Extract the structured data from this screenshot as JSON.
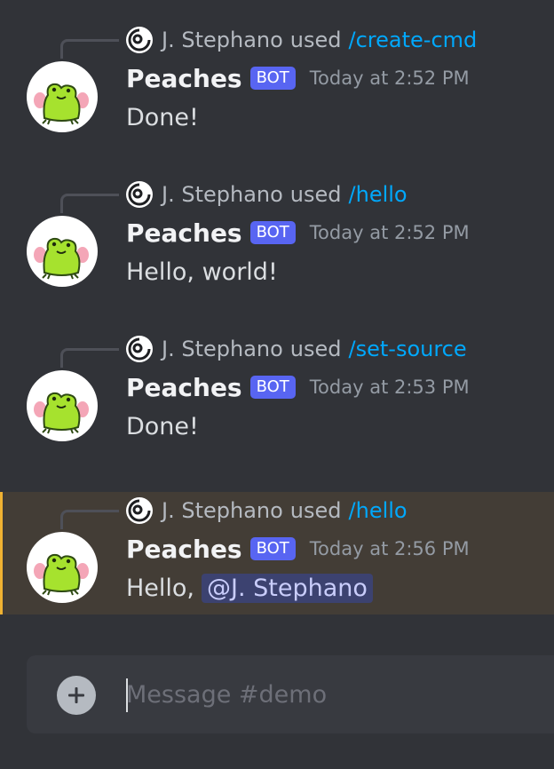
{
  "channel": {
    "composer_placeholder": "Message #demo"
  },
  "colors": {
    "background": "#313338",
    "bot_badge": "#5865f2",
    "command_link": "#00a8fc",
    "mention_bg": "#3c4270",
    "highlight_bg": "#433d36",
    "highlight_bar": "#f0b232"
  },
  "messages": [
    {
      "reply": {
        "user": "J. Stephano",
        "verb": "used",
        "command": "/create-cmd"
      },
      "author": "Peaches",
      "badge": "BOT",
      "timestamp": "Today at 2:52 PM",
      "text": "Done!"
    },
    {
      "reply": {
        "user": "J. Stephano",
        "verb": "used",
        "command": "/hello"
      },
      "author": "Peaches",
      "badge": "BOT",
      "timestamp": "Today at 2:52 PM",
      "text": "Hello, world!"
    },
    {
      "reply": {
        "user": "J. Stephano",
        "verb": "used",
        "command": "/set-source"
      },
      "author": "Peaches",
      "badge": "BOT",
      "timestamp": "Today at 2:53 PM",
      "text": "Done!"
    },
    {
      "reply": {
        "user": "J. Stephano",
        "verb": "used",
        "command": "/hello"
      },
      "author": "Peaches",
      "badge": "BOT",
      "timestamp": "Today at 2:56 PM",
      "text": "Hello,",
      "mention": "@J. Stephano",
      "highlighted": true
    }
  ],
  "icons": {
    "avatar": "frog-avatar-icon",
    "reply_avatar": "user-avatar-icon",
    "add": "plus-circle-icon"
  }
}
